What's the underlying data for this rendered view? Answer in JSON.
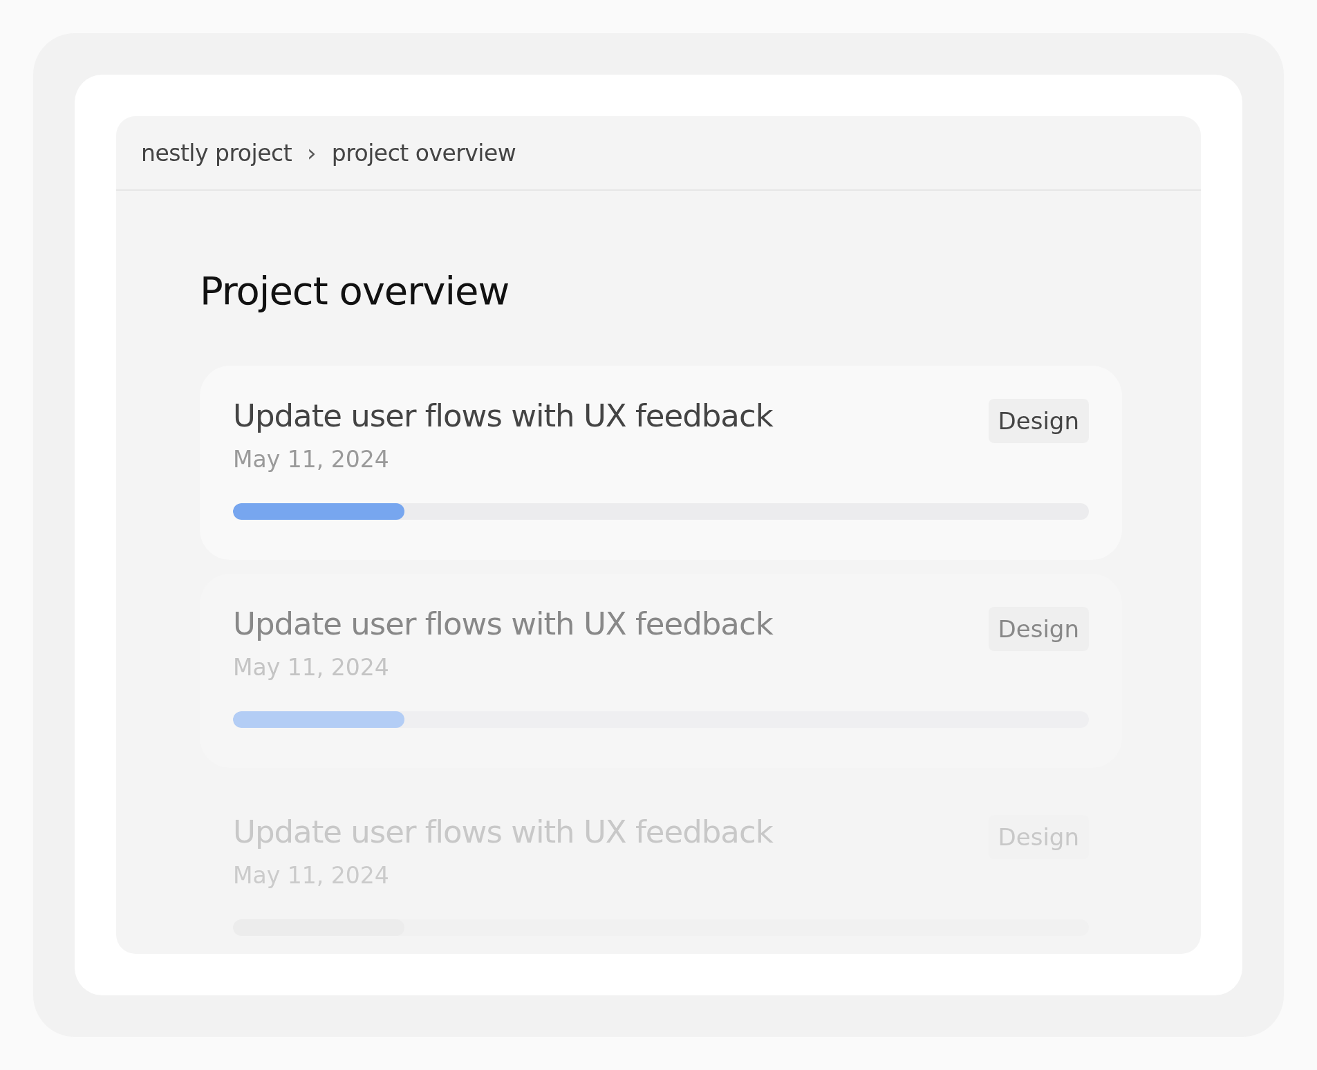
{
  "breadcrumb": [
    {
      "label": "nestly project"
    },
    {
      "label": "project overview"
    }
  ],
  "breadcrumb_separator": "›",
  "title": "Project overview",
  "tasks": [
    {
      "kind": "primary",
      "title": "Update user flows with UX feedback",
      "date": "May 11, 2024",
      "tag": "Design",
      "level": 0.2
    },
    {
      "kind": "secondary",
      "title": "Update user flows with UX feedback",
      "date": "May 11, 2024",
      "tag": "Design",
      "level": 0.2
    },
    {
      "kind": "muted",
      "title": "Update user flows with UX feedback",
      "date": "May 11, 2024",
      "tag": "Design",
      "level": 0.2
    }
  ]
}
